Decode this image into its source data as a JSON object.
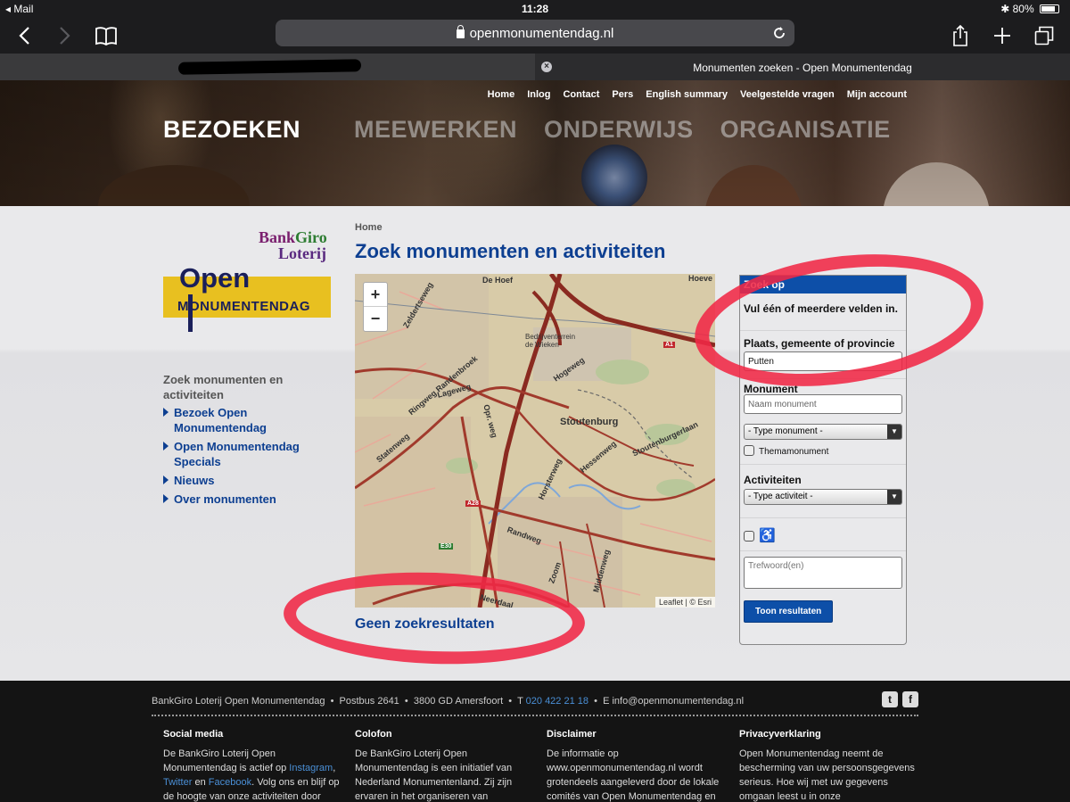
{
  "statusbar": {
    "carrier": "◂ Mail",
    "time": "11:28",
    "battery": "80%"
  },
  "browser": {
    "url": "openmonumentendag.nl"
  },
  "tabs": {
    "active_title": "Monumenten zoeken - Open Monumentendag"
  },
  "topnav": [
    "Home",
    "Inlog",
    "Contact",
    "Pers",
    "English summary",
    "Veelgestelde vragen",
    "Mijn account"
  ],
  "mainnav": [
    "BEZOEKEN",
    "MEEWERKEN",
    "ONDERWIJS",
    "ORGANISATIE"
  ],
  "logos": {
    "bankgiro_1a": "Bank",
    "bankgiro_1b": "Giro",
    "bankgiro_2": "Loterij",
    "omd_open": "Open",
    "omd_mon": "MONUMENTENDAG"
  },
  "sidenav": {
    "title": "Zoek monumenten en activiteiten",
    "items": [
      "Bezoek Open Monumentendag",
      "Open Monumentendag Specials",
      "Nieuws",
      "Over monumenten"
    ]
  },
  "breadcrumb": "Home",
  "page_title": "Zoek monumenten en activiteiten",
  "map": {
    "zoom_in": "+",
    "zoom_out": "−",
    "attribution": "Leaflet | © Esri",
    "labels": [
      "De Hoef",
      "Hoeve",
      "Bedrijventerrein de Wieken",
      "Stoutenburg",
      "Lageweg",
      "Opr. weg",
      "Hogeweg",
      "Horsterweg",
      "Hessenweg",
      "Stoutenburgerlaan",
      "Randweg",
      "Zoom",
      "Middenweg",
      "Ringweg Randenbroek",
      "Zeldertseweg",
      "Statenweg",
      "Neerdaal"
    ],
    "shields": [
      "A1",
      "A28",
      "E30"
    ]
  },
  "no_results": "Geen zoekresultaten",
  "search_panel": {
    "header": "Zoek op",
    "intro": "Vul één of meerdere velden in.",
    "place_label": "Plaats, gemeente of provincie",
    "place_value": "Putten",
    "monument_label": "Monument",
    "monument_placeholder": "Naam monument",
    "type_monument": "- Type monument -",
    "thema_label": "Themamonument",
    "activity_label": "Activiteiten",
    "type_activity": "- Type activiteit -",
    "wheelchair": "♿",
    "keyword_placeholder": "Trefwoord(en)",
    "submit": "Toon resultaten"
  },
  "footer": {
    "org": "BankGiro Loterij Open Monumentendag",
    "postbus": "Postbus 2641",
    "address": "3800 GD Amersfoort",
    "phone_prefix": "T",
    "phone": "020 422 21 18",
    "email": "E info@openmonumentendag.nl",
    "social": [
      "t",
      "f"
    ],
    "columns": [
      {
        "title": "Social media",
        "text_a": "De BankGiro Loterij Open Monumentendag is actief op",
        "link_a": "Instagram",
        "sep": ",",
        "link_b": "Twitter",
        "and": "en",
        "link_c": "Facebook",
        "text_b": ". Volg ons en blijf op de hoogte van onze activiteiten door"
      },
      {
        "title": "Colofon",
        "text": "De BankGiro Loterij Open Monumentendag is een initiatief van Nederland Monumentenland. Zij zijn ervaren in het organiseren van"
      },
      {
        "title": "Disclaimer",
        "text": "De informatie op www.openmonumentendag.nl wordt grotendeels aangeleverd door de lokale comités van Open Monumentendag en"
      },
      {
        "title": "Privacyverklaring",
        "text": "Open Monumentendag neemt de bescherming van uw persoonsgegevens serieus. Hoe wij met uw gegevens omgaan leest u in onze"
      }
    ]
  },
  "colors": {
    "brand_blue": "#0d3f91",
    "panel_blue": "#0d4fa8",
    "annotation_red": "#f02846",
    "logo_yellow": "#e8c020"
  }
}
